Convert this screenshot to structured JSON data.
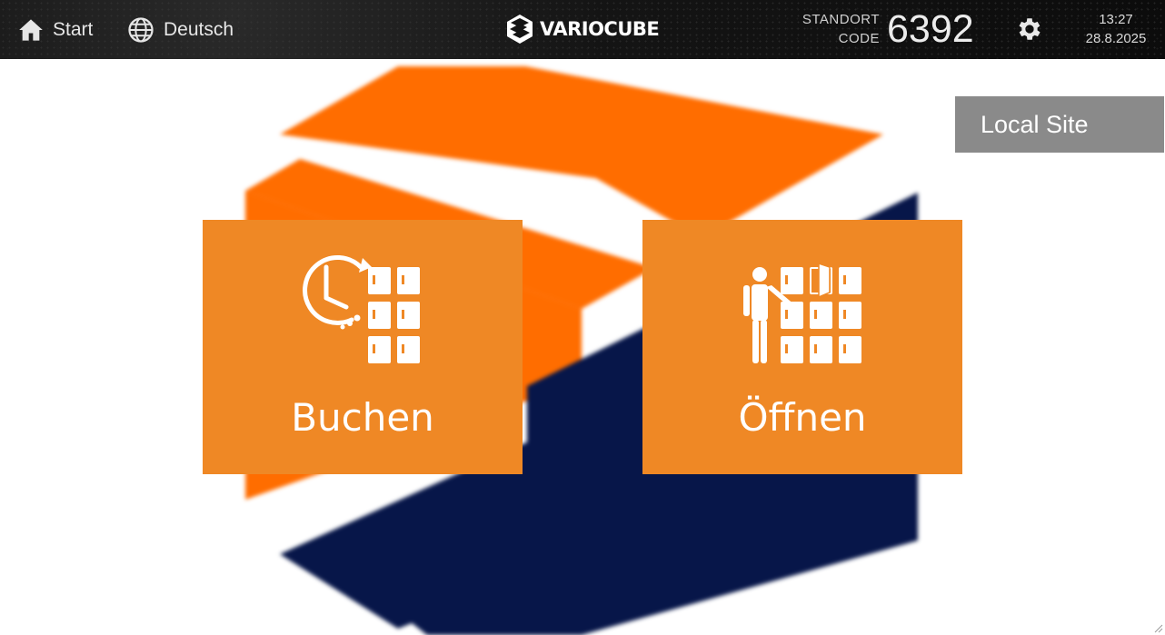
{
  "header": {
    "home_label": "Start",
    "home_icon": "home-icon",
    "language_label": "Deutsch",
    "language_icon": "globe-icon",
    "brand": "VARIOCUBE",
    "location_code_label_line1": "STANDORT",
    "location_code_label_line2": "CODE",
    "location_code": "6392",
    "settings_icon": "gear-icon",
    "time": "13:27",
    "date": "28.8.2025"
  },
  "site_badge": {
    "label": "Local Site"
  },
  "tiles": [
    {
      "label": "Buchen",
      "icon": "clock-lockers-icon"
    },
    {
      "label": "Öffnen",
      "icon": "person-open-locker-icon"
    }
  ],
  "colors": {
    "tile": "#ef8825",
    "logo_orange": "#ff6d00",
    "logo_navy": "#0b1a4a",
    "badge": "#8a8a8a",
    "topbar": "#141414"
  }
}
